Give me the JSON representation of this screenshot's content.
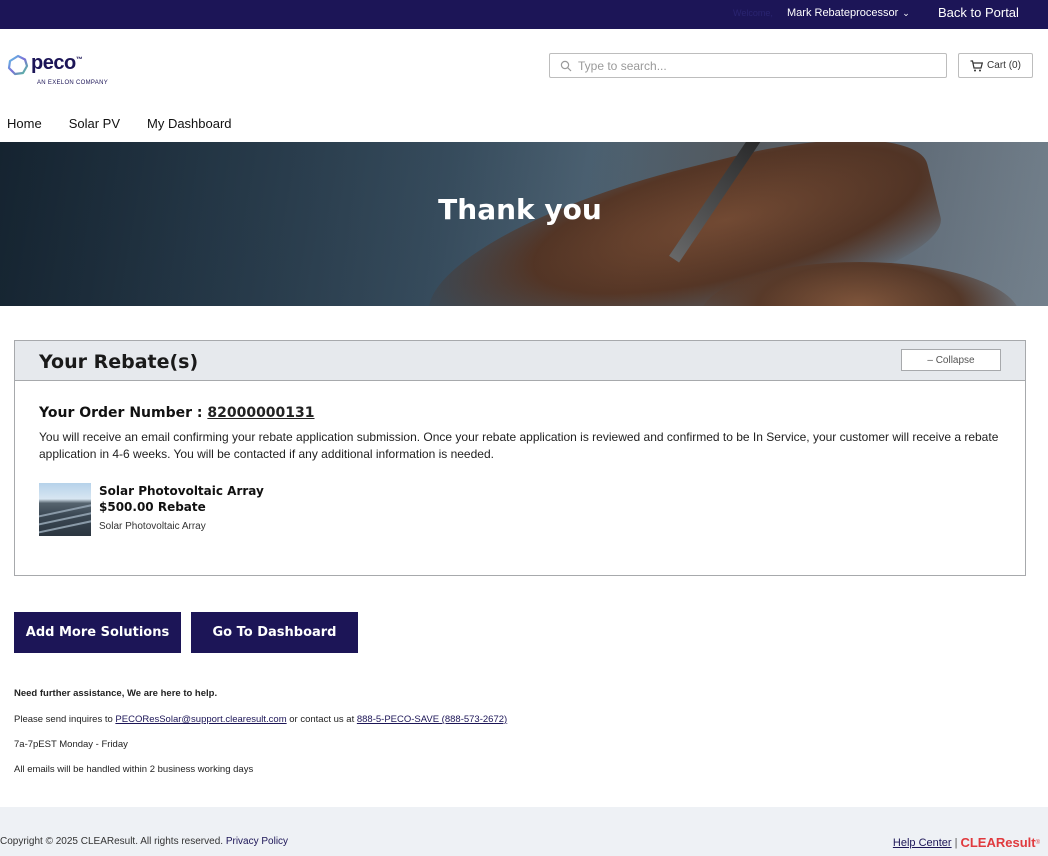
{
  "topbar": {
    "welcome": "Welcome,",
    "user_name": "Mark Rebateprocessor",
    "back_to_portal": "Back to Portal"
  },
  "header": {
    "logo_text": "peco",
    "logo_tm": "™",
    "logo_sub": "AN EXELON COMPANY",
    "search_placeholder": "Type to search...",
    "cart_label": "Cart (0)"
  },
  "nav": {
    "items": [
      {
        "label": "Home"
      },
      {
        "label": "Solar PV"
      },
      {
        "label": "My Dashboard"
      }
    ]
  },
  "hero": {
    "title": "Thank you"
  },
  "rebate_panel": {
    "title": "Your Rebate(s)",
    "collapse_label": "– Collapse",
    "order_label": "Your Order Number :",
    "order_number": "82000000131",
    "message": "You will receive an email confirming your rebate application submission. Once your rebate application is reviewed and confirmed to be In Service, your customer will receive a rebate application in 4-6 weeks. You will be contacted if any additional information is needed.",
    "product": {
      "name": "Solar Photovoltaic Array",
      "rebate": "$500.00 Rebate",
      "description": "Solar Photovoltaic Array"
    }
  },
  "actions": {
    "add_more": "Add More Solutions",
    "dashboard": "Go To Dashboard"
  },
  "help": {
    "heading": "Need further assistance, We are here to help.",
    "contact_prefix": "Please send inquires to",
    "email": "PECOResSolar@support.clearesult.com",
    "contact_mid": "or contact us at",
    "phone": "888-5-PECO-SAVE (888-573-2672)",
    "hours": "7a-7pEST Monday - Friday",
    "response": "All emails will be handled within 2 business working days"
  },
  "footer": {
    "copyright": "Copyright © 2025 CLEAResult. All rights reserved.",
    "privacy": "Privacy Policy",
    "help_center": "Help Center",
    "separator": "|",
    "brand": "CLEAResult",
    "brand_mark": "®"
  },
  "colors": {
    "brand_navy": "#1c1557",
    "panel_header": "#e6e9ed",
    "footer_bg": "#eef1f5",
    "clearesult_red": "#e03a3e"
  },
  "icons": [
    "chevron-down-icon",
    "search-icon",
    "cart-icon",
    "peco-logo-icon"
  ]
}
